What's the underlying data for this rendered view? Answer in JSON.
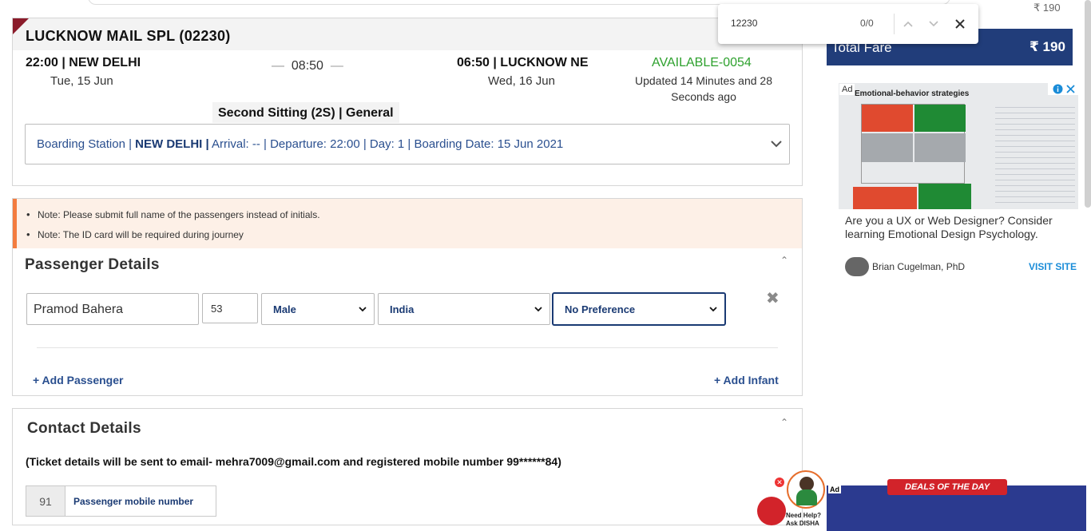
{
  "train": {
    "name": "LUCKNOW MAIL SPL (02230)",
    "departure_time": "22:00 | NEW DELHI",
    "departure_date": "Tue, 15 Jun",
    "duration": "08:50",
    "arrival_time": "06:50 | LUCKNOW NE",
    "arrival_date": "Wed, 16 Jun",
    "availability": "AVAILABLE-0054",
    "updated": "Updated 14 Minutes and 28 Seconds ago",
    "class_label": "Second Sitting (2S) | General",
    "boarding": {
      "prefix": "Boarding Station | ",
      "station": "NEW DELHI |",
      "details": " Arrival: -- | Departure: 22:00 | Day: 1 | Boarding Date: 15 Jun 2021"
    }
  },
  "notes": [
    "Note: Please submit full name of the passengers instead of initials.",
    "Note: The ID card will be required during journey"
  ],
  "passenger_section": {
    "title": "Passenger Details",
    "passenger": {
      "name": "Pramod Bahera",
      "age": "53",
      "gender": "Male",
      "country": "India",
      "berth_preference": "No Preference"
    },
    "add_passenger": "+ Add Passenger",
    "add_infant": "+ Add Infant"
  },
  "contact_section": {
    "title": "Contact Details",
    "info": "(Ticket details will be sent to email- mehra7009@gmail.com and registered mobile number 99******84)",
    "country_code": "91",
    "mobile_placeholder": "Passenger mobile number"
  },
  "fare": {
    "previous": "₹ 190",
    "label": "Total Fare",
    "value": "₹ 190"
  },
  "find_bar": {
    "query": "12230",
    "count": "0/0"
  },
  "ad": {
    "badge": "Ad",
    "image_title": "Emotional-behavior strategies",
    "text": "Are you a UX or Web Designer? Consider learning Emotional Design Psychology.",
    "author": "Brian Cugelman, PhD",
    "cta": "VISIT SITE"
  },
  "bottom_ads": {
    "badge": "Ad",
    "deals": "DEALS OF THE DAY",
    "help": "Need Help? Ask DISHA"
  },
  "colors": {
    "navy": "#213d7a",
    "available": "#2ea12e",
    "note_accent": "#f37c3f",
    "note_bg": "#fdf0e7",
    "flag": "#8b1c2b"
  }
}
